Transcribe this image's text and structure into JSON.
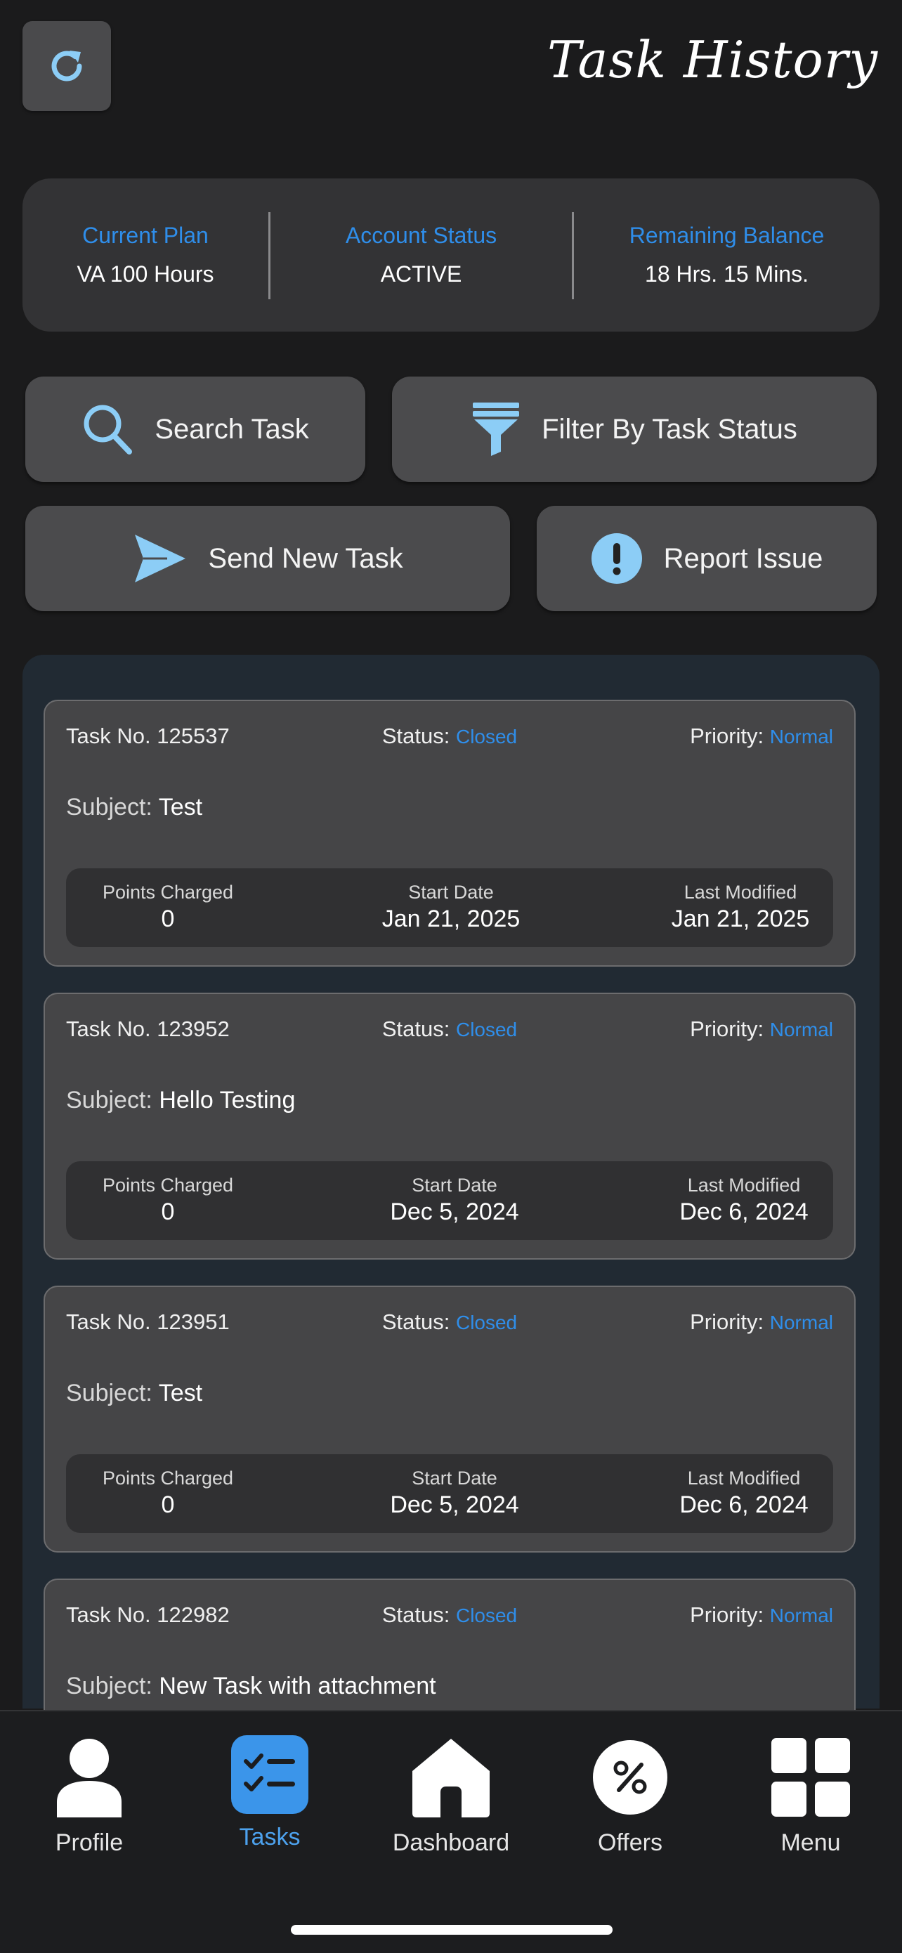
{
  "header": {
    "title": "Task History",
    "refresh_icon": "refresh-icon"
  },
  "plan": {
    "current_plan_label": "Current Plan",
    "current_plan_value": "VA 100 Hours",
    "account_status_label": "Account Status",
    "account_status_value": "ACTIVE",
    "remaining_balance_label": "Remaining Balance",
    "remaining_balance_value": "18 Hrs. 15 Mins."
  },
  "actions": {
    "search": "Search Task",
    "filter": "Filter By Task Status",
    "send": "Send New Task",
    "report": "Report Issue"
  },
  "labels": {
    "task_no": "Task No.",
    "status": "Status:",
    "priority": "Priority:",
    "subject": "Subject:",
    "points_charged": "Points Charged",
    "start_date": "Start Date",
    "last_modified": "Last Modified"
  },
  "tasks": [
    {
      "no": "125537",
      "status": "Closed",
      "priority": "Normal",
      "subject": "Test",
      "points": "0",
      "start": "Jan 21, 2025",
      "modified": "Jan 21, 2025"
    },
    {
      "no": "123952",
      "status": "Closed",
      "priority": "Normal",
      "subject": "Hello Testing",
      "points": "0",
      "start": "Dec 5, 2024",
      "modified": "Dec 6, 2024"
    },
    {
      "no": "123951",
      "status": "Closed",
      "priority": "Normal",
      "subject": "Test",
      "points": "0",
      "start": "Dec 5, 2024",
      "modified": "Dec 6, 2024"
    },
    {
      "no": "122982",
      "status": "Closed",
      "priority": "Normal",
      "subject": "New Task with attachment",
      "points": "",
      "start": "",
      "modified": ""
    }
  ],
  "nav": {
    "items": [
      {
        "label": "Profile",
        "icon": "person-icon",
        "active": false
      },
      {
        "label": "Tasks",
        "icon": "checklist-icon",
        "active": true
      },
      {
        "label": "Dashboard",
        "icon": "home-icon",
        "active": false
      },
      {
        "label": "Offers",
        "icon": "percent-icon",
        "active": false
      },
      {
        "label": "Menu",
        "icon": "grid-icon",
        "active": false
      }
    ]
  },
  "colors": {
    "accent": "#2f8eea",
    "icon_light_blue": "#8ccdf6",
    "background": "#1b1b1c",
    "card": "#454547",
    "panel": "#212a33"
  }
}
